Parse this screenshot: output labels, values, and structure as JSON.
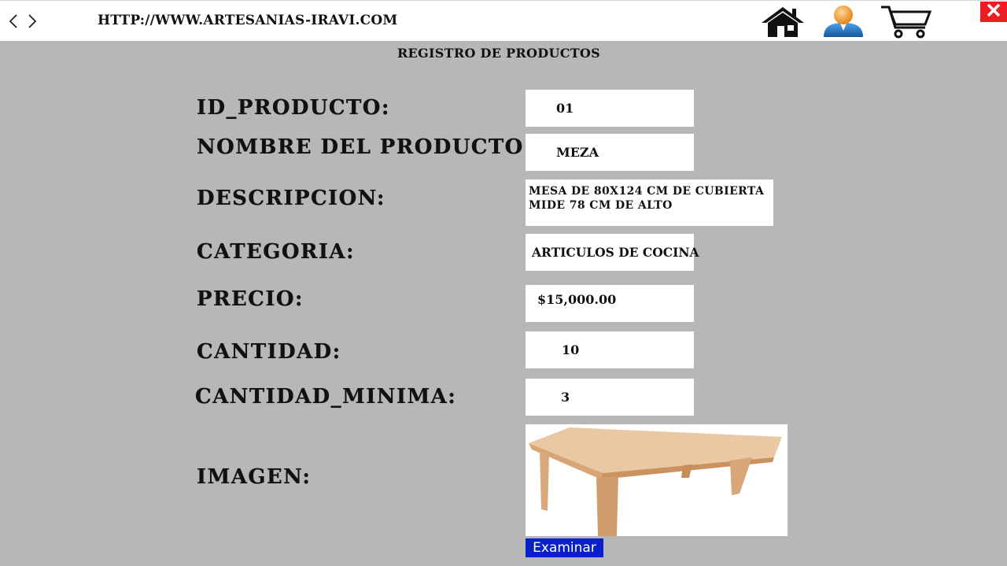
{
  "browser": {
    "url": "HTTP://WWW.ARTESANIAS-IRAVI.COM",
    "icons": {
      "back": "chevron-left-icon",
      "forward": "chevron-right-icon",
      "home": "home-icon",
      "user": "user-icon",
      "cart": "cart-icon",
      "close": "close-icon"
    }
  },
  "page": {
    "title": "REGISTRO DE PRODUCTOS"
  },
  "form": {
    "id": {
      "label": "ID_PRODUCTO:",
      "value": "01"
    },
    "name": {
      "label": "NOMBRE DEL PRODUCTO:",
      "value": "MEZA"
    },
    "description": {
      "label": "DESCRIPCION:",
      "value": "MESA DE 80X124 CM DE CUBIERTA MIDE 78 CM DE ALTO"
    },
    "category": {
      "label": "CATEGORIA:",
      "value": "ARTICULOS DE COCINA"
    },
    "price": {
      "label": "PRECIO:",
      "value": "$15,000.00"
    },
    "quantity": {
      "label": "CANTIDAD:",
      "value": "10"
    },
    "min_quantity": {
      "label": "CANTIDAD_MINIMA:",
      "value": "3"
    },
    "image": {
      "label": "IMAGEN:",
      "browse_label": "Examinar"
    }
  },
  "colors": {
    "background": "#b7b7b7",
    "browse_button": "#0a1fcc",
    "close_button": "#ee1d24",
    "user_icon": "#1f6fbf",
    "table_wood": "#e6be95"
  }
}
